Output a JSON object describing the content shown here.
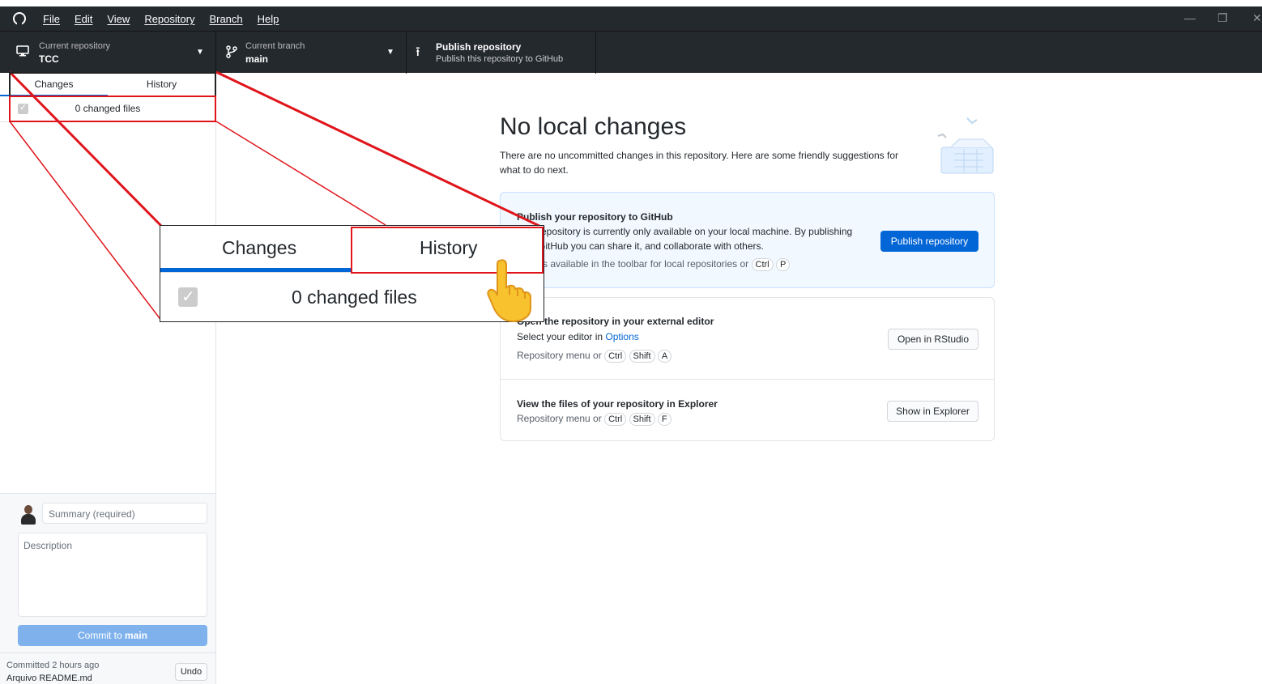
{
  "menu": [
    "File",
    "Edit",
    "View",
    "Repository",
    "Branch",
    "Help"
  ],
  "window_controls": {
    "minimize": "—",
    "restore": "❐",
    "close": "✕"
  },
  "toolbar": {
    "repo": {
      "caption": "Current repository",
      "value": "TCC"
    },
    "branch": {
      "caption": "Current branch",
      "value": "main"
    },
    "publish": {
      "title": "Publish repository",
      "subtitle": "Publish this repository to GitHub"
    }
  },
  "sidebar": {
    "tabs": [
      "Changes",
      "History"
    ],
    "changed_files": "0 changed files",
    "commit": {
      "summary_placeholder": "Summary (required)",
      "description_placeholder": "Description",
      "button_prefix": "Commit to ",
      "button_branch": "main"
    },
    "last_commit": {
      "time": "Committed 2 hours ago",
      "message": "Arquivo README.md",
      "undo": "Undo"
    }
  },
  "main": {
    "title": "No local changes",
    "subtitle": "There are no uncommitted changes in this repository. Here are some friendly suggestions for what to do next.",
    "publish_card": {
      "title": "Publish your repository to GitHub",
      "text1": "This repository is currently only available on your local machine. By publishing",
      "text2": "it on GitHub you can share it, and collaborate with others.",
      "hint_prefix": "Always available in the toolbar for local repositories or",
      "keys": [
        "Ctrl",
        "P"
      ],
      "button": "Publish repository"
    },
    "editor_card": {
      "title": "Open the repository in your external editor",
      "text_prefix": "Select your editor in ",
      "text_link": "Options",
      "hint_prefix": "Repository menu or",
      "keys": [
        "Ctrl",
        "Shift",
        "A"
      ],
      "button": "Open in RStudio"
    },
    "explorer_card": {
      "title": "View the files of your repository in Explorer",
      "hint_prefix": "Repository menu or",
      "keys": [
        "Ctrl",
        "Shift",
        "F"
      ],
      "button": "Show in Explorer"
    }
  },
  "zoom": {
    "tabs": [
      "Changes",
      "History"
    ],
    "changed_files": "0 changed files"
  },
  "colors": {
    "accent": "#0366d6",
    "highlight": "#e0151b",
    "dark": "#24292e"
  }
}
